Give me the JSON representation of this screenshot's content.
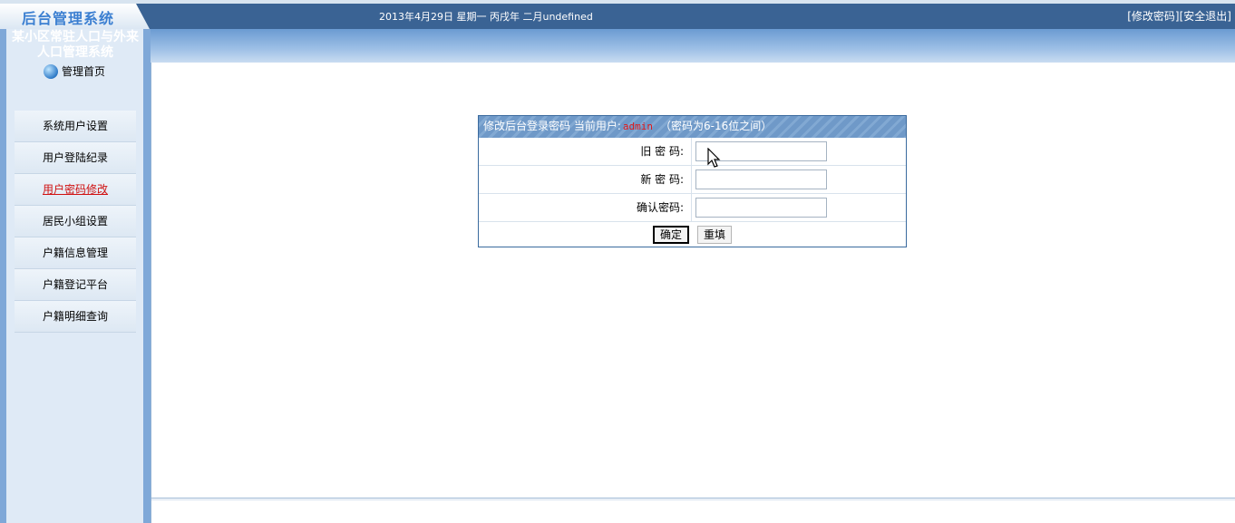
{
  "header": {
    "logo_text": "后台管理系统",
    "date_text": "2013年4月29日 星期一 丙戌年 二月undefined",
    "change_password_link": "[修改密码]",
    "logout_link": "[安全退出]"
  },
  "sidebar": {
    "system_title_line1": "某小区常驻人口与外来",
    "system_title_line2": "人口管理系统",
    "home_label": "管理首页",
    "items": [
      {
        "label": "系统用户设置"
      },
      {
        "label": "用户登陆纪录"
      },
      {
        "label": "用户密码修改"
      },
      {
        "label": "居民小组设置"
      },
      {
        "label": "户籍信息管理"
      },
      {
        "label": "户籍登记平台"
      },
      {
        "label": "户籍明细查询"
      }
    ],
    "active_index": 2
  },
  "form": {
    "title": "修改后台登录密码 当前用户:",
    "current_user": "admin",
    "hint": "（密码为6-16位之间）",
    "old_password_label": "旧 密 码:",
    "old_password_value": "",
    "new_password_label": "新 密 码:",
    "new_password_value": "",
    "confirm_password_label": "确认密码:",
    "confirm_password_value": "",
    "submit_label": "确定",
    "reset_label": "重填"
  },
  "colors": {
    "header_bg": "#3a6394",
    "active_menu": "#d01010",
    "user_name": "#e01818"
  }
}
